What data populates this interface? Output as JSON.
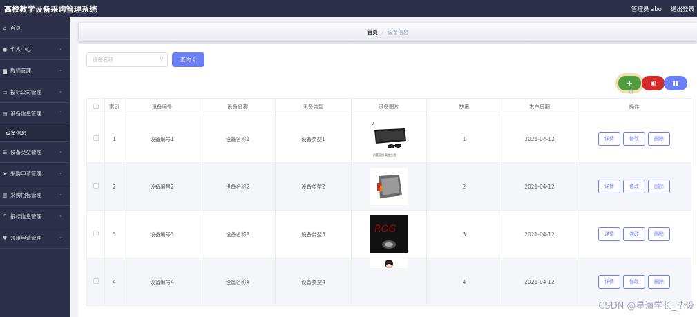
{
  "header": {
    "title": "高校教学设备采购管理系统",
    "user_label": "管理员 abo",
    "logout_label": "退出登录"
  },
  "sidebar": {
    "items": [
      {
        "icon": "home-icon",
        "glyph": "⌂",
        "label": "首页",
        "has_chevron": false
      },
      {
        "icon": "user-icon",
        "glyph": "●",
        "label": "个人中心",
        "has_chevron": true
      },
      {
        "icon": "teacher-icon",
        "glyph": "▆",
        "label": "教师管理",
        "has_chevron": true
      },
      {
        "icon": "company-icon",
        "glyph": "▭",
        "label": "投标公司管理",
        "has_chevron": true
      },
      {
        "icon": "device-icon",
        "glyph": "▤",
        "label": "设备信息管理",
        "has_chevron": true,
        "expanded": true
      }
    ],
    "submenu_label": "设备信息",
    "items_after": [
      {
        "icon": "list-icon",
        "glyph": "☰",
        "label": "设备类型管理",
        "has_chevron": true
      },
      {
        "icon": "send-icon",
        "glyph": "➤",
        "label": "采购申请管理",
        "has_chevron": true
      },
      {
        "icon": "chart-icon",
        "glyph": "▥",
        "label": "采购招标管理",
        "has_chevron": true
      },
      {
        "icon": "bracket-icon",
        "glyph": "⌜",
        "label": "投标信息管理",
        "has_chevron": true
      },
      {
        "icon": "heart-icon",
        "glyph": "♥",
        "label": "领用申请管理",
        "has_chevron": true
      }
    ]
  },
  "breadcrumb": {
    "home": "首页",
    "separator": "/",
    "current": "设备信息"
  },
  "search": {
    "placeholder": "设备名称",
    "button_label": "查询 ⚲"
  },
  "toolbar": {
    "add_glyph": "+",
    "delete_glyph": "🗑",
    "stats_glyph": "▮▮"
  },
  "table": {
    "headers": [
      "",
      "索引",
      "设备编号",
      "设备名称",
      "设备类型",
      "设备图片",
      "数量",
      "发布日期",
      "操作"
    ],
    "rows": [
      {
        "index": "1",
        "code": "设备编号1",
        "name": "设备名称1",
        "type": "设备类型1",
        "image": "keyboard-mouse-image",
        "qty": "1",
        "date": "2021-04-12"
      },
      {
        "index": "2",
        "code": "设备编号2",
        "name": "设备名称2",
        "type": "设备类型2",
        "image": "power-supply-image",
        "qty": "2",
        "date": "2021-04-12"
      },
      {
        "index": "3",
        "code": "设备编号3",
        "name": "设备名称3",
        "type": "设备类型3",
        "image": "rog-logo-image",
        "qty": "3",
        "date": "2021-04-12"
      },
      {
        "index": "4",
        "code": "设备编号4",
        "name": "设备名称4",
        "type": "设备类型4",
        "image": "partial-image",
        "qty": "4",
        "date": "2021-04-12"
      }
    ],
    "actions": {
      "detail": "详情",
      "edit": "修改",
      "delete": "删除"
    }
  },
  "watermark": "CSDN @星海学长_毕设",
  "colors": {
    "sidebar_bg": "#2c3149",
    "primary": "#6a7ef5",
    "add": "#4f9b3f",
    "danger": "#d42b2b"
  }
}
